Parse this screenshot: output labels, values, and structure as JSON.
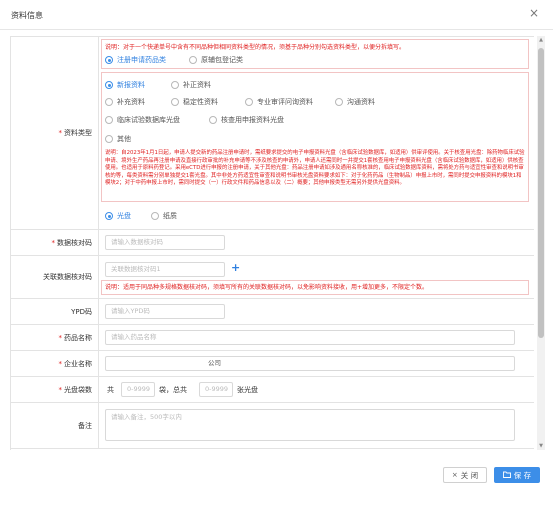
{
  "dialog": {
    "title": "资料信息",
    "close_glyph": "×"
  },
  "material_type": {
    "label": "资料类型",
    "note_top": "说明：对于一个快递单号中含有不同品种但相同资料类型的情况，须基于品种分别勾选资料类型，以便分拆填写。",
    "category_options": [
      {
        "label": "注册申请药品类",
        "selected": true
      },
      {
        "label": "原辅包登记类",
        "selected": false
      }
    ],
    "type_options": [
      {
        "label": "新报资料",
        "selected": true
      },
      {
        "label": "补正资料",
        "selected": false
      },
      {
        "label": "补充资料",
        "selected": false
      },
      {
        "label": "稳定性资料",
        "selected": false
      },
      {
        "label": "专业审评问询资料",
        "selected": false
      },
      {
        "label": "沟通资料",
        "selected": false
      },
      {
        "label": "临床试验数据库光盘",
        "selected": false
      },
      {
        "label": "核查用申报资料光盘",
        "selected": false
      },
      {
        "label": "其他",
        "selected": false
      }
    ],
    "note_long": "说明：自2023年1月1日起，申请人提交新的药品注册申请时，需纸要求提交的电子申报资料光盘（含临床试验数据库，如适用）供审评使用。关于核查用光盘：除药物临床试验申请、境外生产药品再注册申请及直接行政审批的补充申请等不涉及核查的申请外，申请人还需同时一并提交1套核查用电子申报资料光盘（含临床试验数据库，如适用）供核查使用。也适用于原料药登记。采用eCTD进行申报的注册申请，关于其他光盘：药品注册申请如涉及通用名称核准的，临床试验数据库资料，需将处方药与适宜性审查和说明书审核的等，每类资料需分别单独提交1套光盘。其中非处方药适宜性审查和说明书审核光盘资料要求如下：对于化药药品（生物制品）申报上市时，需同时提交申报资料的模块1和模块2；对于中药申报上市时，需同时提交（一）行政文件和药品信息以及（二）概要；其他申报类型无需另外提供光盘资料。",
    "medium_options": [
      {
        "label": "光盘",
        "selected": true
      },
      {
        "label": "纸质",
        "selected": false
      }
    ]
  },
  "data_check_code": {
    "label": "数据核对码",
    "placeholder": "请输入数据核对码"
  },
  "related_check_code": {
    "label": "关联数据核对码",
    "placeholder": "关联数据核对码1",
    "add_glyph": "+",
    "note": "说明：适用于同品种多规格数据核对码，须填写所有的关联数据核对码，以免影响资料接收，用+增加更多，不限定个数。"
  },
  "ypd": {
    "label": "YPD码",
    "placeholder": "请输入YPD码"
  },
  "drug_name": {
    "label": "药品名称",
    "placeholder": "请输入药品名称"
  },
  "company": {
    "label": "企业名称",
    "value": "公司"
  },
  "disc_count": {
    "label": "光盘袋数",
    "prefix": "共",
    "placeholder_a": "0-9999",
    "middle": "袋，总共",
    "placeholder_b": "0-9999",
    "suffix": "张光盘"
  },
  "remark": {
    "label": "备注",
    "placeholder": "请输入备注，500字以内"
  },
  "footer": {
    "close_label": "关 闭",
    "save_label": "保 存",
    "close_icon": "×",
    "save_icon": "folder"
  },
  "colors": {
    "accent": "#3c8ee8",
    "danger": "#e02020",
    "border": "#e3e3e3"
  }
}
